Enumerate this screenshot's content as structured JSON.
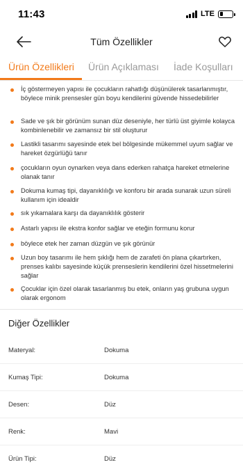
{
  "status_bar": {
    "time": "11:43",
    "network": "LTE",
    "battery_level": 0.25
  },
  "header": {
    "title": "Tüm Özellikler",
    "back_icon": "arrow-left-icon",
    "favorite_icon": "heart-icon"
  },
  "tabs": [
    {
      "label": "Ürün Özellikleri",
      "active": true
    },
    {
      "label": "Ürün Açıklaması",
      "active": false
    },
    {
      "label": "İade Koşulları",
      "active": false
    }
  ],
  "features": [
    "İç göstermeyen yapısı ile çocukların rahatlığı düşünülerek tasarlanmıştır, böylece minik prensesler gün boyu kendilerini güvende hissedebilirler",
    "Sade ve şık bir görünüm sunan düz deseniyle, her türlü üst giyimle kolayca kombinlenebilir ve zamansız bir stil oluşturur",
    "Lastikli tasarımı sayesinde etek bel bölgesinde mükemmel uyum sağlar ve hareket özgürlüğü tanır",
    "çocukların oyun oynarken veya dans ederken rahatça hareket etmelerine olanak tanır",
    "Dokuma kumaş tipi, dayanıklılığı ve konforu bir arada sunarak uzun süreli kullanım için idealdir",
    "sık yıkamalara karşı da dayanıklılık gösterir",
    "Astarlı yapısı ile ekstra konfor sağlar ve eteğin formunu korur",
    "böylece etek her zaman düzgün ve şık görünür",
    "Uzun boy tasarımı ile hem şıklığı hem de zarafeti ön plana çıkartırken, prenses kalıbı sayesinde küçük prenseslerin kendilerini özel hissetmelerini sağlar",
    "Çocuklar için özel olarak tasarlanmış bu etek, onların yaş grubuna uygun olarak ergonom"
  ],
  "other_features": {
    "title": "Diğer Özellikler",
    "rows": [
      {
        "label": "Materyal:",
        "value": "Dokuma"
      },
      {
        "label": "Kumaş Tipi:",
        "value": "Dokuma"
      },
      {
        "label": "Desen:",
        "value": "Düz"
      },
      {
        "label": "Renk:",
        "value": "Mavi"
      },
      {
        "label": "Ürün Tipi:",
        "value": "Düz"
      }
    ]
  },
  "colors": {
    "accent": "#f27a1a",
    "text": "#333333",
    "muted": "#999999"
  }
}
